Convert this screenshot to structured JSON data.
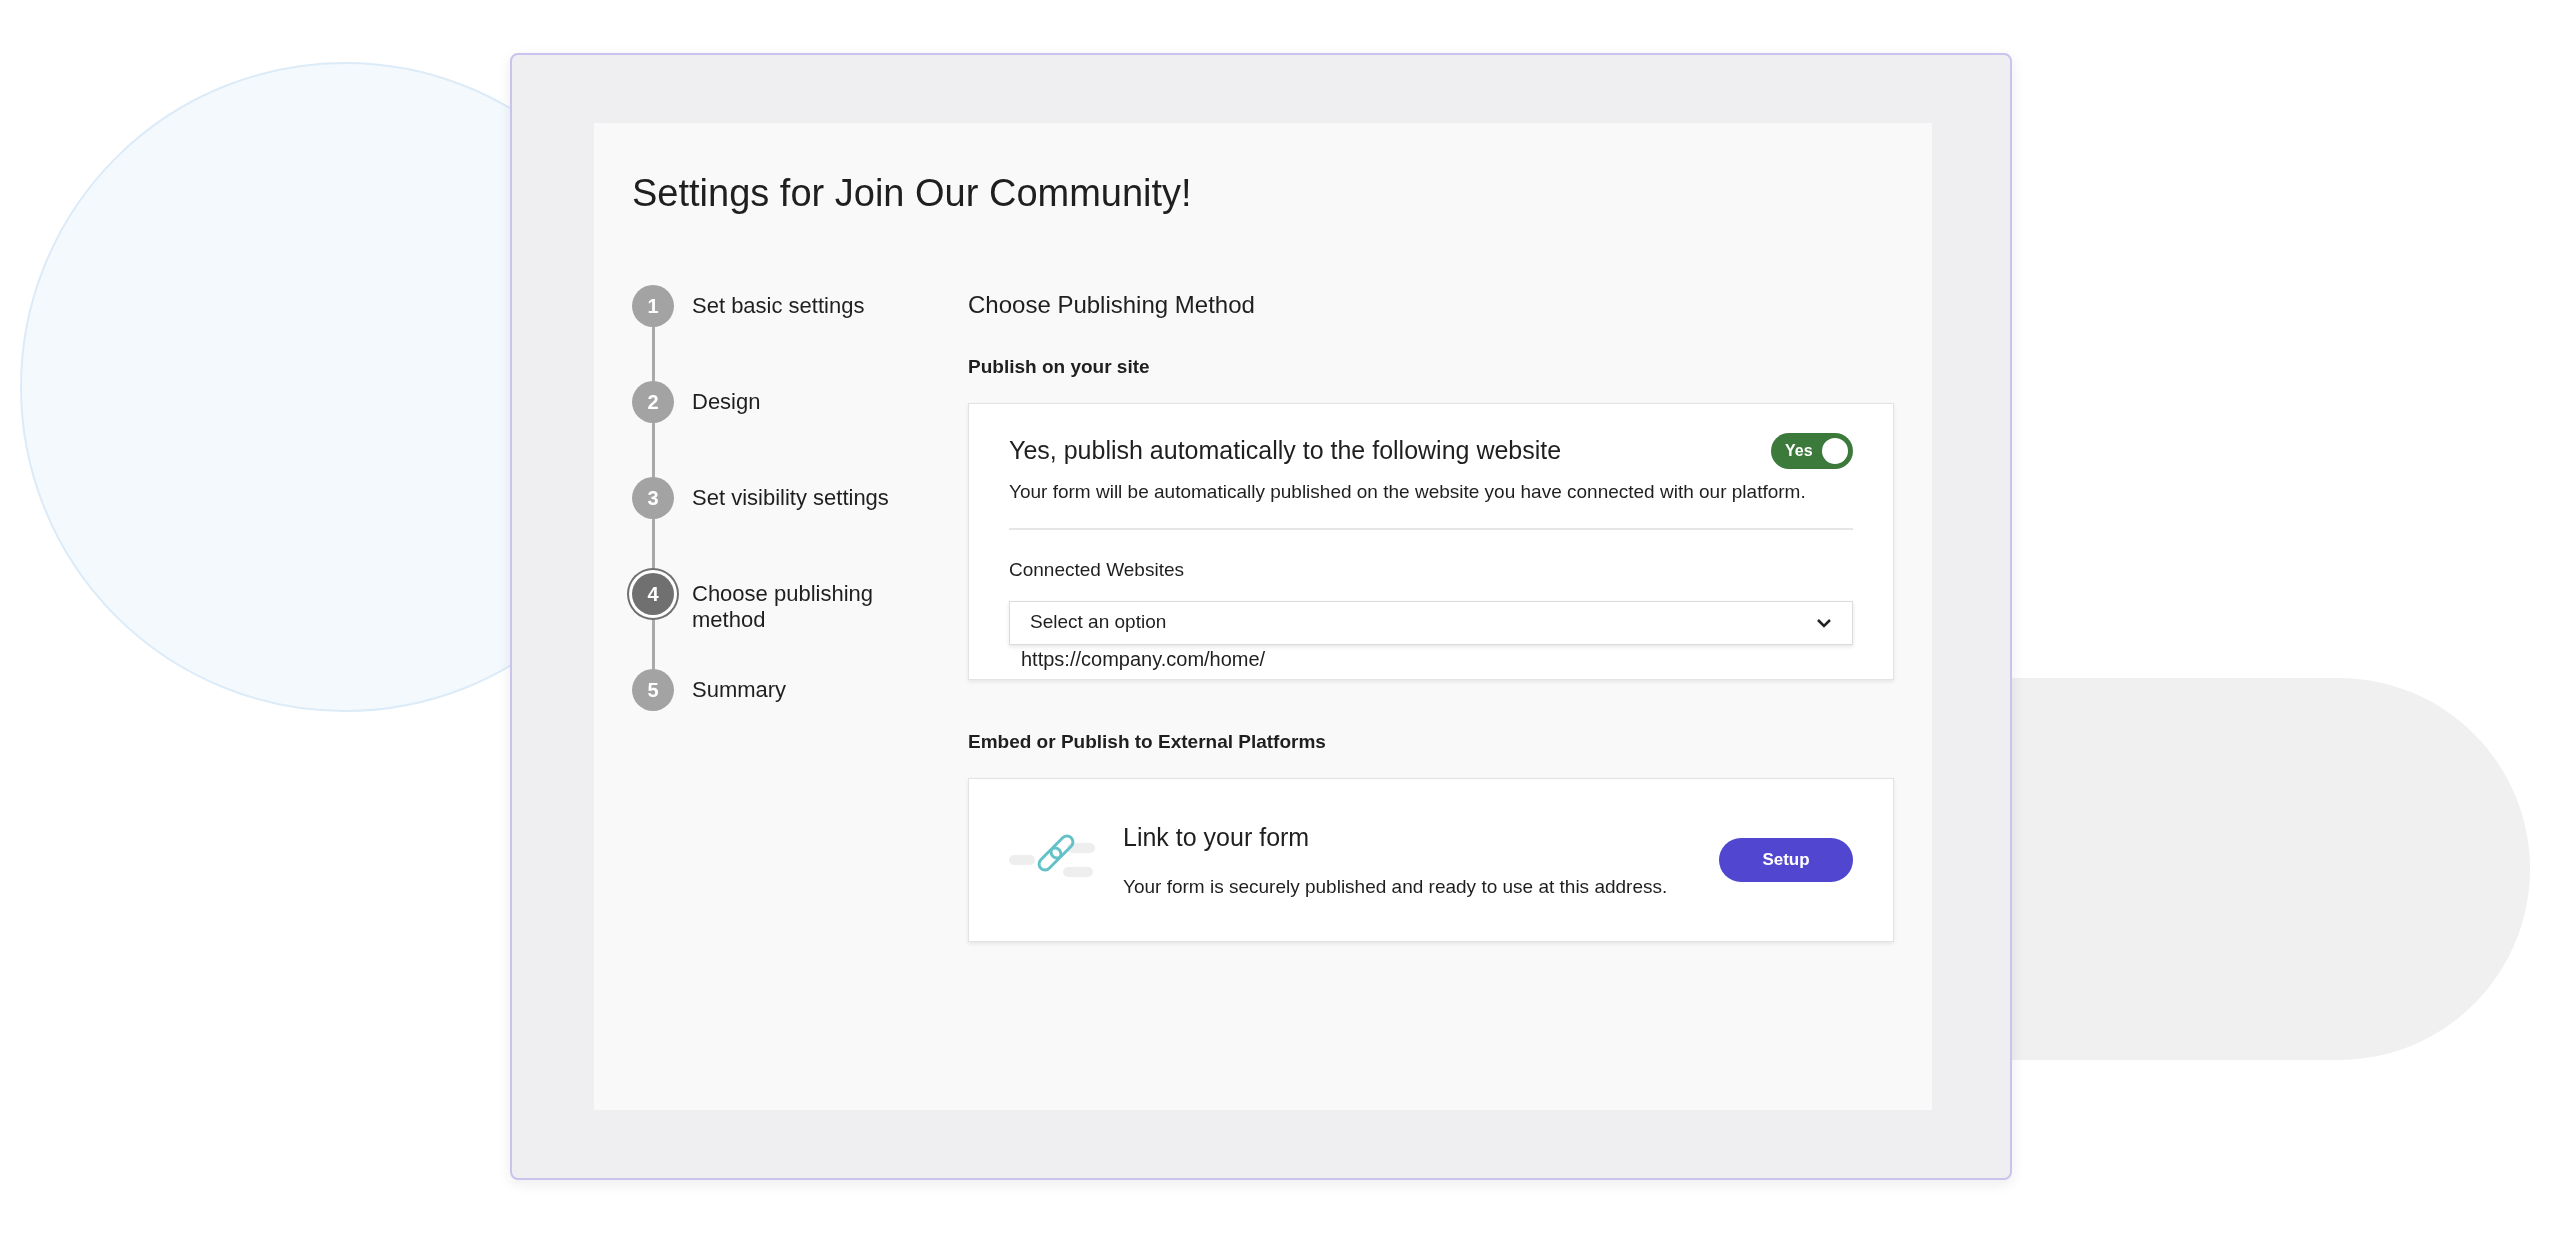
{
  "title": "Settings for Join Our Community!",
  "steps": [
    {
      "number": "1",
      "label": "Set basic settings",
      "selected": false
    },
    {
      "number": "2",
      "label": "Design",
      "selected": false
    },
    {
      "number": "3",
      "label": "Set visibility settings",
      "selected": false
    },
    {
      "number": "4",
      "label": "Choose publishing method",
      "selected": true
    },
    {
      "number": "5",
      "label": "Summary",
      "selected": false
    }
  ],
  "heading": "Choose Publishing Method",
  "site_section": {
    "label": "Publish on your site",
    "title": "Yes, publish automatically to the following website",
    "toggle": {
      "label": "Yes",
      "on": true
    },
    "description": "Your form will be automatically published on the website you have connected with our platform.",
    "field_label": "Connected Websites",
    "select": {
      "value": "Select an option"
    },
    "dropdown_item": "https://company.com/home/"
  },
  "external_section": {
    "label": "Embed or Publish to External Platforms",
    "title": "Link to your form",
    "description": "Your form is securely published and ready to use at this address.",
    "button": "Setup"
  }
}
